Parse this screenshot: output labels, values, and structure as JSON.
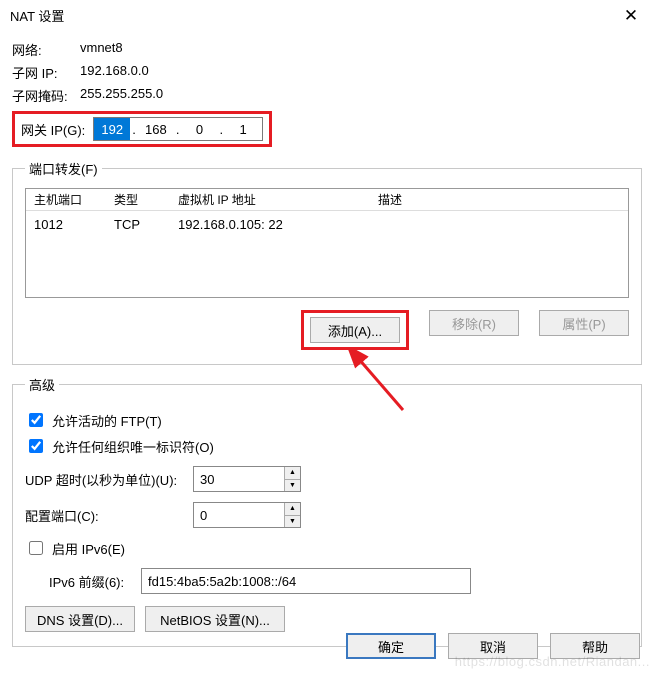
{
  "title": "NAT 设置",
  "info": {
    "network_label": "网络:",
    "network_value": "vmnet8",
    "subnet_ip_label": "子网 IP:",
    "subnet_ip_value": "192.168.0.0",
    "subnet_mask_label": "子网掩码:",
    "subnet_mask_value": "255.255.255.0"
  },
  "gateway": {
    "label": "网关 IP(G):",
    "oct1": "192",
    "oct2": "168",
    "oct3": "0",
    "oct4": "1"
  },
  "port_forward": {
    "legend": "端口转发(F)",
    "cols": {
      "host_port": "主机端口",
      "type": "类型",
      "vm_ip": "虚拟机 IP 地址",
      "desc": "描述"
    },
    "rows": [
      {
        "host_port": "1012",
        "type": "TCP",
        "vm_ip": "192.168.0.105: 22",
        "desc": ""
      }
    ],
    "buttons": {
      "add": "添加(A)...",
      "remove": "移除(R)",
      "props": "属性(P)"
    }
  },
  "advanced": {
    "legend": "高级",
    "allow_active_ftp": "允许活动的 FTP(T)",
    "allow_oui": "允许任何组织唯一标识符(O)",
    "udp_timeout_label": "UDP 超时(以秒为单位)(U):",
    "udp_timeout_value": "30",
    "config_port_label": "配置端口(C):",
    "config_port_value": "0",
    "enable_ipv6": "启用 IPv6(E)",
    "ipv6_prefix_label": "IPv6 前缀(6):",
    "ipv6_prefix_value": "fd15:4ba5:5a2b:1008::/64",
    "dns_btn": "DNS 设置(D)...",
    "netbios_btn": "NetBIOS 设置(N)..."
  },
  "footer": {
    "ok": "确定",
    "cancel": "取消",
    "help": "帮助"
  },
  "watermark": "https://blog.csdn.net/Riandan..."
}
